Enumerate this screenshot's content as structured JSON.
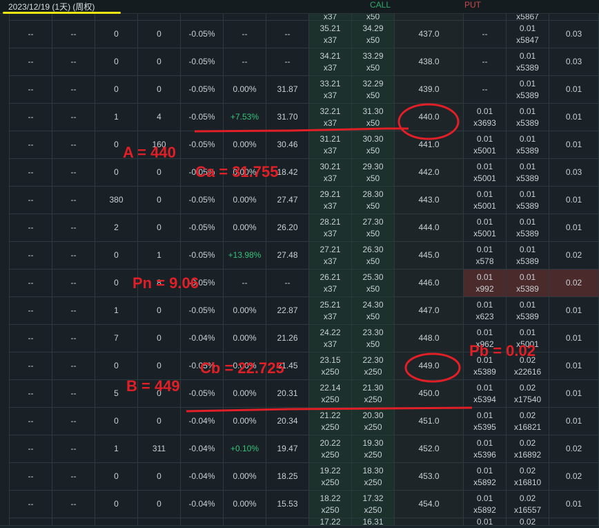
{
  "header": {
    "date_label": "2023/12/19 (1天) (周权)",
    "call_label": "CALL",
    "put_label": "PUT"
  },
  "partial_top_row": [
    "",
    "",
    "",
    "",
    "",
    "",
    "",
    "x37",
    "x50",
    "",
    "",
    "x5867",
    ""
  ],
  "rows": [
    [
      "--",
      "--",
      "0",
      "0",
      "-0.05%",
      "--",
      "--",
      [
        "35.21",
        "x37"
      ],
      [
        "34.29",
        "x50"
      ],
      "437.0",
      "--",
      [
        "0.01",
        "x5847"
      ],
      "0.03"
    ],
    [
      "--",
      "--",
      "0",
      "0",
      "-0.05%",
      "--",
      "--",
      [
        "34.21",
        "x37"
      ],
      [
        "33.29",
        "x50"
      ],
      "438.0",
      "--",
      [
        "0.01",
        "x5389"
      ],
      "0.03"
    ],
    [
      "--",
      "--",
      "0",
      "0",
      "-0.05%",
      "0.00%",
      "31.87",
      [
        "33.21",
        "x37"
      ],
      [
        "32.29",
        "x50"
      ],
      "439.0",
      "--",
      [
        "0.01",
        "x5389"
      ],
      "0.01"
    ],
    [
      "--",
      "--",
      "1",
      "4",
      "-0.05%",
      "+7.53%",
      "31.70",
      [
        "32.21",
        "x37"
      ],
      [
        "31.30",
        "x50"
      ],
      "440.0",
      [
        "0.01",
        "x3693"
      ],
      [
        "0.01",
        "x5389"
      ],
      "0.01"
    ],
    [
      "--",
      "--",
      "0",
      "160",
      "-0.05%",
      "0.00%",
      "30.46",
      [
        "31.21",
        "x37"
      ],
      [
        "30.30",
        "x50"
      ],
      "441.0",
      [
        "0.01",
        "x5001"
      ],
      [
        "0.01",
        "x5389"
      ],
      "0.01"
    ],
    [
      "--",
      "--",
      "0",
      "0",
      "-0.05%",
      "0.00%",
      "18.42",
      [
        "30.21",
        "x37"
      ],
      [
        "29.30",
        "x50"
      ],
      "442.0",
      [
        "0.01",
        "x5001"
      ],
      [
        "0.01",
        "x5389"
      ],
      "0.03"
    ],
    [
      "--",
      "--",
      "380",
      "0",
      "-0.05%",
      "0.00%",
      "27.47",
      [
        "29.21",
        "x37"
      ],
      [
        "28.30",
        "x50"
      ],
      "443.0",
      [
        "0.01",
        "x5001"
      ],
      [
        "0.01",
        "x5389"
      ],
      "0.01"
    ],
    [
      "--",
      "--",
      "2",
      "0",
      "-0.05%",
      "0.00%",
      "26.20",
      [
        "28.21",
        "x37"
      ],
      [
        "27.30",
        "x50"
      ],
      "444.0",
      [
        "0.01",
        "x5001"
      ],
      [
        "0.01",
        "x5389"
      ],
      "0.01"
    ],
    [
      "--",
      "--",
      "0",
      "1",
      "-0.05%",
      "+13.98%",
      "27.48",
      [
        "27.21",
        "x37"
      ],
      [
        "26.30",
        "x50"
      ],
      "445.0",
      [
        "0.01",
        "x578"
      ],
      [
        "0.01",
        "x5389"
      ],
      "0.02"
    ],
    [
      "--",
      "--",
      "0",
      "8",
      "-0.05%",
      "--",
      "--",
      [
        "26.21",
        "x37"
      ],
      [
        "25.30",
        "x50"
      ],
      "446.0",
      [
        "0.01",
        "x992"
      ],
      [
        "0.01",
        "x5389"
      ],
      "0.02"
    ],
    [
      "--",
      "--",
      "1",
      "0",
      "-0.05%",
      "0.00%",
      "22.87",
      [
        "25.21",
        "x37"
      ],
      [
        "24.30",
        "x50"
      ],
      "447.0",
      [
        "0.01",
        "x623"
      ],
      [
        "0.01",
        "x5389"
      ],
      "0.01"
    ],
    [
      "--",
      "--",
      "7",
      "0",
      "-0.04%",
      "0.00%",
      "21.26",
      [
        "24.22",
        "x37"
      ],
      [
        "23.30",
        "x50"
      ],
      "448.0",
      [
        "0.01",
        "x962"
      ],
      [
        "0.01",
        "x5001"
      ],
      "0.01"
    ],
    [
      "--",
      "--",
      "0",
      "0",
      "-0.05%",
      "0.00%",
      "21.45",
      [
        "23.15",
        "x250"
      ],
      [
        "22.30",
        "x250"
      ],
      "449.0",
      [
        "0.01",
        "x5389"
      ],
      [
        "0.02",
        "x22616"
      ],
      "0.01"
    ],
    [
      "--",
      "--",
      "5",
      "0",
      "-0.05%",
      "0.00%",
      "20.31",
      [
        "22.14",
        "x250"
      ],
      [
        "21.30",
        "x250"
      ],
      "450.0",
      [
        "0.01",
        "x5394"
      ],
      [
        "0.02",
        "x17540"
      ],
      "0.01"
    ],
    [
      "--",
      "--",
      "0",
      "0",
      "-0.04%",
      "0.00%",
      "20.34",
      [
        "21.22",
        "x250"
      ],
      [
        "20.30",
        "x250"
      ],
      "451.0",
      [
        "0.01",
        "x5395"
      ],
      [
        "0.02",
        "x16821"
      ],
      "0.01"
    ],
    [
      "--",
      "--",
      "1",
      "311",
      "-0.04%",
      "+0.10%",
      "19.47",
      [
        "20.22",
        "x250"
      ],
      [
        "19.30",
        "x250"
      ],
      "452.0",
      [
        "0.01",
        "x5396"
      ],
      [
        "0.02",
        "x16892"
      ],
      "0.02"
    ],
    [
      "--",
      "--",
      "0",
      "0",
      "-0.04%",
      "0.00%",
      "18.25",
      [
        "19.22",
        "x250"
      ],
      [
        "18.30",
        "x250"
      ],
      "453.0",
      [
        "0.01",
        "x5892"
      ],
      [
        "0.02",
        "x16810"
      ],
      "0.02"
    ],
    [
      "--",
      "--",
      "0",
      "0",
      "-0.04%",
      "0.00%",
      "15.53",
      [
        "18.22",
        "x250"
      ],
      [
        "17.32",
        "x250"
      ],
      "454.0",
      [
        "0.01",
        "x5892"
      ],
      [
        "0.02",
        "x16557"
      ],
      "0.01"
    ]
  ],
  "partial_bottom_row": [
    "",
    "",
    "",
    "",
    "",
    "",
    "",
    "17.22",
    "16.31",
    "",
    "0.01",
    "0.02",
    ""
  ],
  "highlight_row_index": 9,
  "annotations": {
    "a": "A = 440",
    "ca": "Ca = 31.755",
    "pn": "Pn = 9.06",
    "b": "B = 449",
    "cb": "Cb = 22.725",
    "pb": "Pb = 0.02"
  },
  "colors": {
    "annotation_red": "#e11f26",
    "highlight_yellow": "#f2e514",
    "gain_green": "#36c27a",
    "call_label": "#2fa86b",
    "put_label": "#c54a4a",
    "highlight_row_bg": "#4a2a2a"
  }
}
